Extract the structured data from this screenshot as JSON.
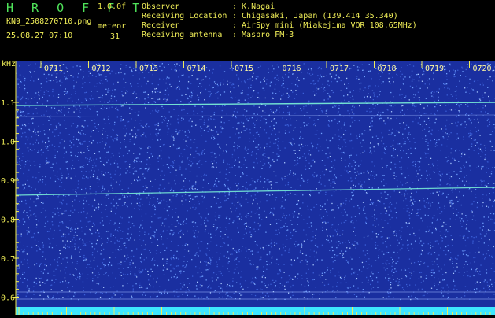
{
  "header": {
    "app_title": "H R O F F T",
    "version": "1.0.0f",
    "filename": "KN9_2508270710.png",
    "datetime": "25.08.27 07:10",
    "meteor_label": "meteor",
    "meteor_count": "31",
    "info": [
      {
        "key": "Observer",
        "value": ": K.Nagai"
      },
      {
        "key": "Receiving Location",
        "value": ": Chigasaki, Japan (139.414 35.340)"
      },
      {
        "key": "Receiver",
        "value": ": AirSpy mini (Miakejima VOR 108.65MHz)"
      },
      {
        "key": "Receiving antenna",
        "value": ": Maspro FM-3"
      }
    ]
  },
  "spectrogram": {
    "y_unit": "kHz",
    "y_ticks": [
      "1.1",
      "1.0",
      "0.9",
      "0.8",
      "0.7",
      "0.6"
    ],
    "time_labels": [
      "0711",
      "0712",
      "0713",
      "0714",
      "0715",
      "0716",
      "0717",
      "0718",
      "0719",
      "0720"
    ],
    "colors": {
      "background": "#1a2fa0",
      "noise": "#6fa0ff",
      "axis": "#f0ee58",
      "baseline": "#3ee6ff",
      "signal": "#7cf5d8"
    }
  }
}
